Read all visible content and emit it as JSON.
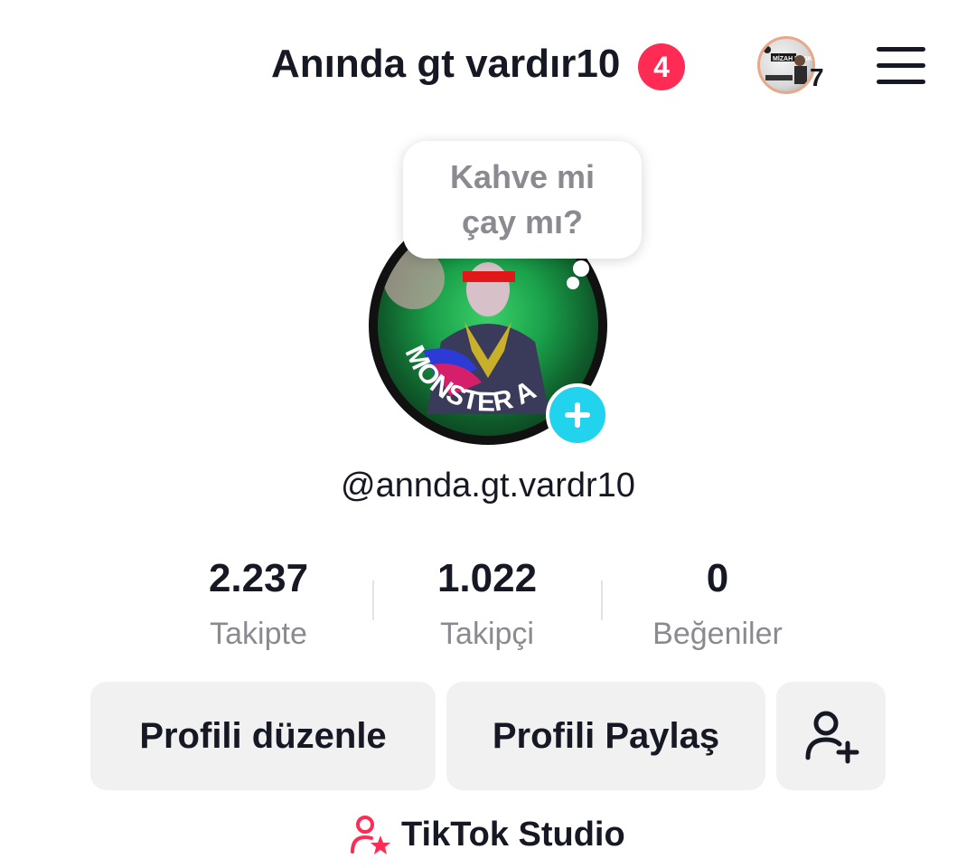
{
  "header": {
    "title": "Anında gt vardır10",
    "notification_count": "4",
    "story_count": "7"
  },
  "note": {
    "text": "Kahve mi çay mı?"
  },
  "profile": {
    "username": "@annda.gt.vardr10",
    "avatar_text": "MONSTER A",
    "story_avatar_text": "MİZAH BASKINI"
  },
  "stats": [
    {
      "value": "2.237",
      "label": "Takipte"
    },
    {
      "value": "1.022",
      "label": "Takipçi"
    },
    {
      "value": "0",
      "label": "Beğeniler"
    }
  ],
  "buttons": {
    "edit_profile": "Profili düzenle",
    "share_profile": "Profili Paylaş"
  },
  "studio": {
    "label": "TikTok Studio"
  },
  "colors": {
    "accent": "#fe2c55",
    "add_button": "#22d3ee",
    "button_bg": "#f1f1f2",
    "muted_text": "#8a8b91"
  }
}
